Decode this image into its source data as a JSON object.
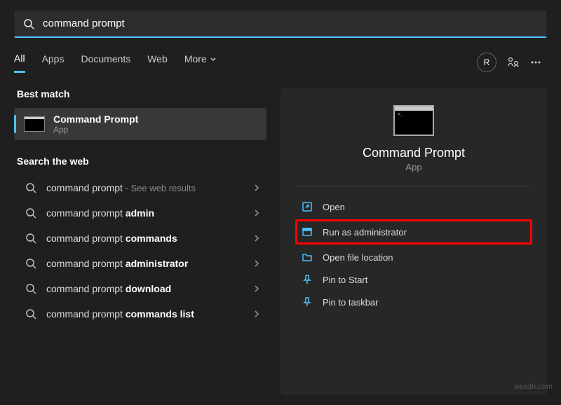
{
  "search": {
    "value": "command prompt"
  },
  "tabs": {
    "items": [
      "All",
      "Apps",
      "Documents",
      "Web",
      "More"
    ],
    "active": 0
  },
  "header": {
    "avatar_letter": "R"
  },
  "left": {
    "best_match_label": "Best match",
    "best_match": {
      "title": "Command Prompt",
      "subtitle": "App"
    },
    "search_web_label": "Search the web",
    "web_items": [
      {
        "prefix": "command prompt",
        "bold": "",
        "hint": " - See web results"
      },
      {
        "prefix": "command prompt ",
        "bold": "admin",
        "hint": ""
      },
      {
        "prefix": "command prompt ",
        "bold": "commands",
        "hint": ""
      },
      {
        "prefix": "command prompt ",
        "bold": "administrator",
        "hint": ""
      },
      {
        "prefix": "command prompt ",
        "bold": "download",
        "hint": ""
      },
      {
        "prefix": "command prompt ",
        "bold": "commands list",
        "hint": ""
      }
    ]
  },
  "right": {
    "title": "Command Prompt",
    "subtitle": "App",
    "actions": [
      {
        "icon": "open",
        "label": "Open",
        "highlighted": false
      },
      {
        "icon": "admin",
        "label": "Run as administrator",
        "highlighted": true
      },
      {
        "icon": "folder",
        "label": "Open file location",
        "highlighted": false
      },
      {
        "icon": "pin",
        "label": "Pin to Start",
        "highlighted": false
      },
      {
        "icon": "pin",
        "label": "Pin to taskbar",
        "highlighted": false
      }
    ]
  },
  "watermark": "wsxdn.com"
}
